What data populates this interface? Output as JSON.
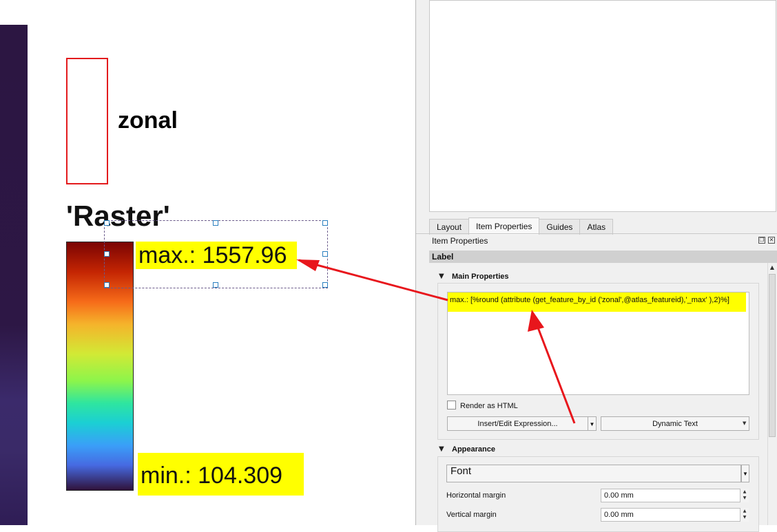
{
  "layout_canvas": {
    "zonal_label": "zonal",
    "raster_title": "'Raster'",
    "max_label": "max.: 1557.96",
    "min_label": "min.: 104.309"
  },
  "panel": {
    "tabs": [
      {
        "label": "Layout",
        "active": false
      },
      {
        "label": "Item Properties",
        "active": true
      },
      {
        "label": "Guides",
        "active": false
      },
      {
        "label": "Atlas",
        "active": false
      }
    ],
    "dock_title": "Item Properties",
    "section_header": "Label",
    "main_properties": {
      "title": "Main Properties",
      "expression_text": "max.: [%round (attribute (get_feature_by_id ('zonal',@atlas_featureid),'_max' ),2)%]",
      "render_as_html_label": "Render as HTML",
      "render_as_html_checked": false,
      "insert_expression_button": "Insert/Edit Expression...",
      "dynamic_text_button": "Dynamic Text"
    },
    "appearance": {
      "title": "Appearance",
      "font_button": "Font",
      "horizontal_margin_label": "Horizontal margin",
      "horizontal_margin_value": "0.00 mm",
      "vertical_margin_label": "Vertical margin",
      "vertical_margin_value": "0.00 mm"
    }
  },
  "colors": {
    "highlight": "#ffff00",
    "annotation_arrow": "#e8161c",
    "zonal_border": "#e31a1c",
    "selection_handle": "#2a7fbf"
  }
}
